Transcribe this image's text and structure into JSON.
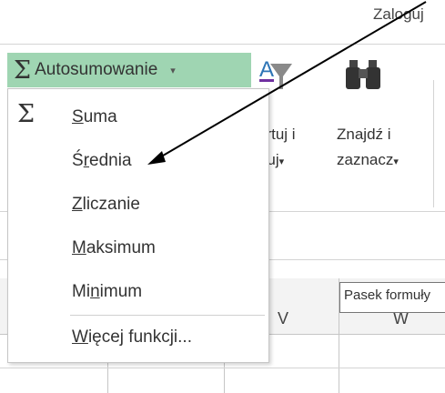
{
  "ribbon": {
    "login_text": "Zaloguj",
    "autosum": {
      "sigma_glyph": "Σ",
      "label": "Autosumowanie",
      "caret": "▾"
    },
    "sort_filter": {
      "line1": "ortuj i",
      "line2": "truj",
      "caret": "▾",
      "icon": "sort-filter-icon"
    },
    "find_select": {
      "line1": "Znajdź i",
      "line2": "zaznacz",
      "caret": "▾",
      "icon": "binoculars-icon"
    },
    "accent_color": "#9fd5b2"
  },
  "menu": {
    "sigma_glyph": "Σ",
    "items": [
      {
        "pre": "",
        "key": "S",
        "post": "uma"
      },
      {
        "pre": "Ś",
        "key": "r",
        "post": "ednia"
      },
      {
        "pre": "",
        "key": "Z",
        "post": "liczanie"
      },
      {
        "pre": "",
        "key": "M",
        "post": "aksimum"
      },
      {
        "pre": "Mi",
        "key": "n",
        "post": "imum"
      },
      {
        "pre": "",
        "key": "W",
        "post": "ięcej funkcji..."
      }
    ]
  },
  "sheet": {
    "columns": [
      "V",
      "W"
    ],
    "tooltip": "Pasek formuły"
  },
  "annotation": {
    "arrow_color": "#000000"
  }
}
